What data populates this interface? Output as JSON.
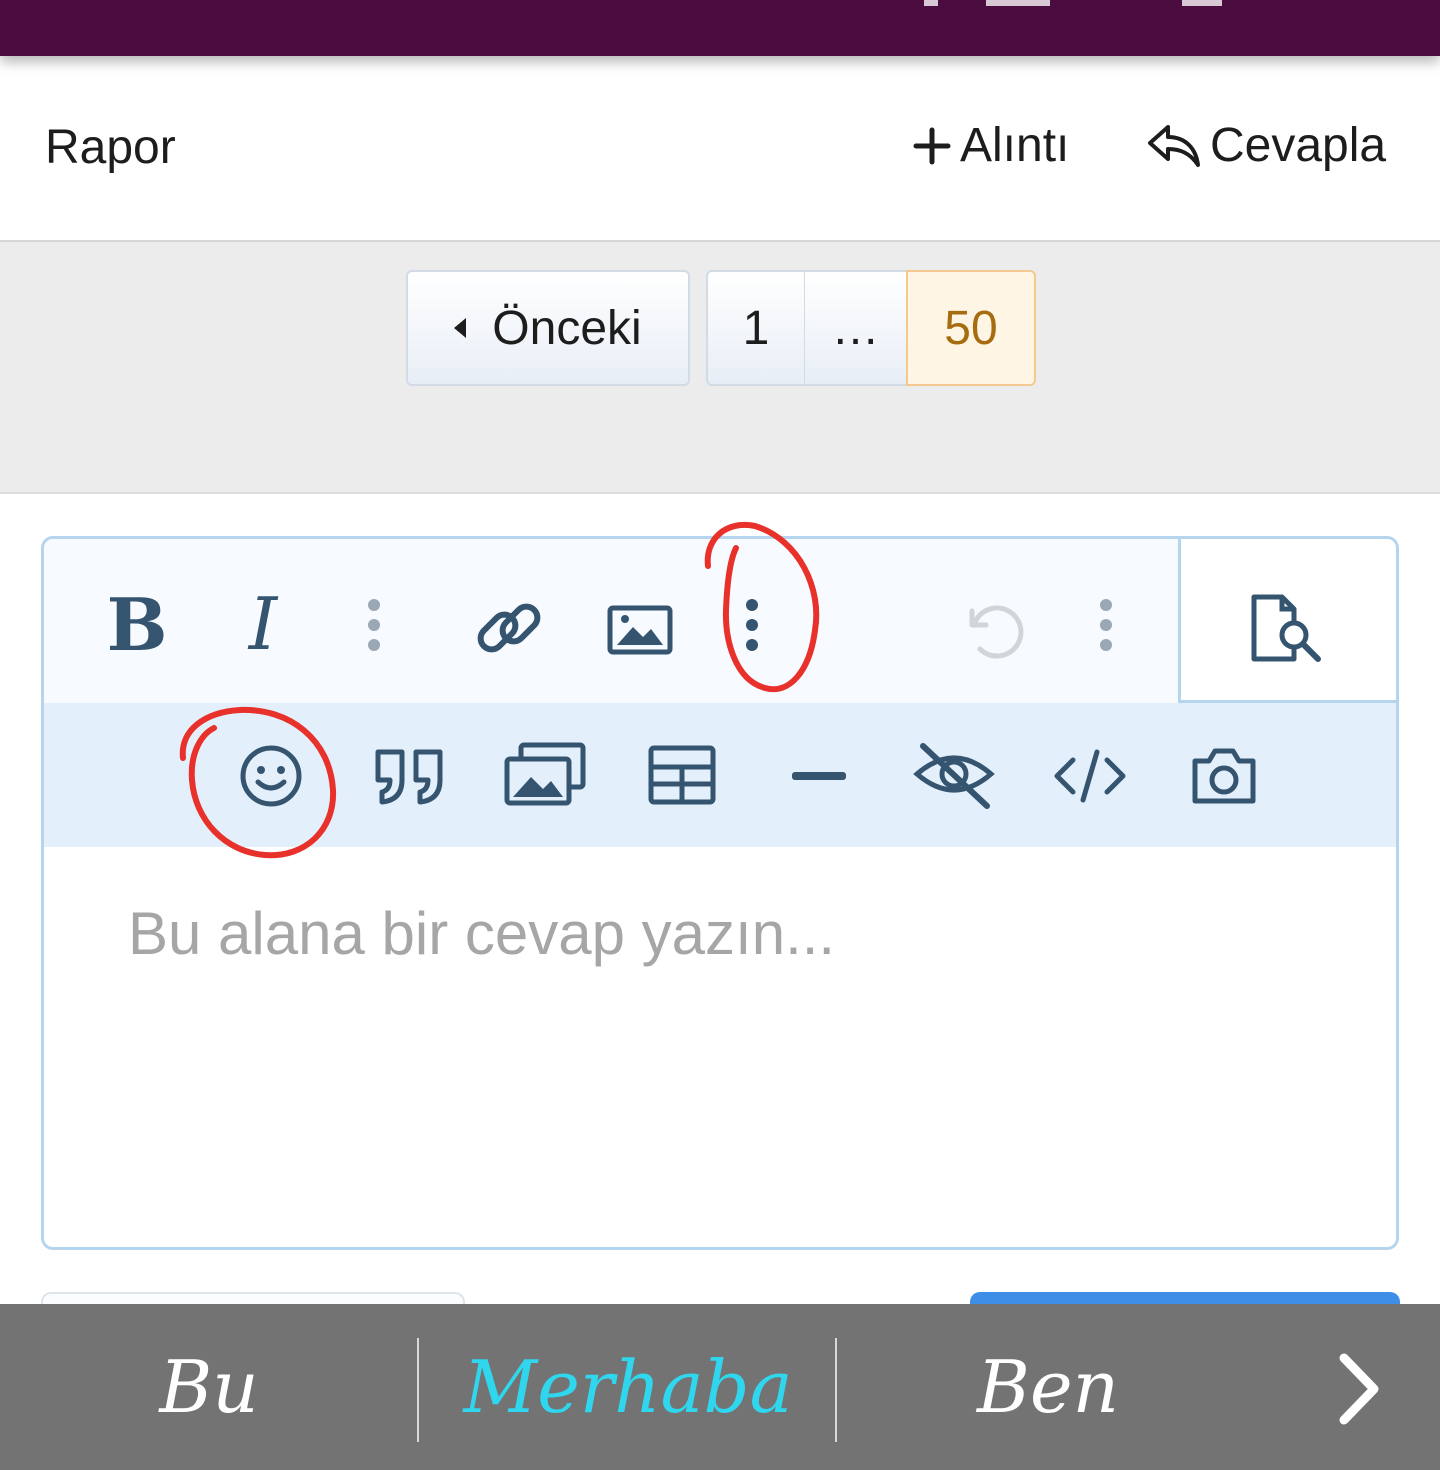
{
  "header": {
    "report_label": "Rapor",
    "quote_label": "Alıntı",
    "reply_label": "Cevapla"
  },
  "pagination": {
    "prev_label": "Önceki",
    "first_page": "1",
    "ellipsis": "…",
    "current_page": "50"
  },
  "editor": {
    "toolbar_row1": [
      "bold-icon",
      "italic-icon",
      "more-text-icon",
      "link-icon",
      "image-icon",
      "more-insert-icon",
      "undo-icon",
      "more-options-icon",
      "preview-icon"
    ],
    "toolbar_row2": [
      "smiley-icon",
      "quote-icon",
      "media-gallery-icon",
      "table-icon",
      "horizontal-line-icon",
      "spoiler-icon",
      "code-icon",
      "camera-icon"
    ],
    "bold_glyph": "B",
    "italic_glyph": "I",
    "placeholder": "Bu alana bir cevap yazın..."
  },
  "keyboard_suggestions": {
    "items": [
      "Bu",
      "Merhaba",
      "Ben"
    ],
    "highlighted": "Merhaba"
  },
  "colors": {
    "topbar": "#4b0c40",
    "icon": "#35546f",
    "current_page_text": "#a86c10",
    "highlight_suggestion": "#2fd6ee",
    "annotation": "#e8312a"
  }
}
